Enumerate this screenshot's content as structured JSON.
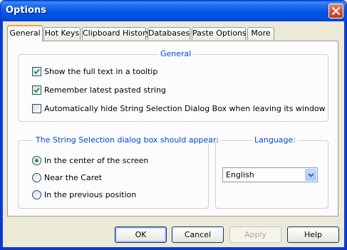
{
  "window": {
    "title": "Options"
  },
  "tabs": [
    {
      "label": "General",
      "active": true
    },
    {
      "label": "Hot Keys",
      "active": false
    },
    {
      "label": "Clipboard History",
      "active": false
    },
    {
      "label": "Databases",
      "active": false
    },
    {
      "label": "Paste Options",
      "active": false
    },
    {
      "label": "More",
      "active": false
    }
  ],
  "general_group": {
    "title": "General",
    "options": [
      {
        "label": "Show the full text in a tooltip",
        "checked": true
      },
      {
        "label": "Remember latest pasted string",
        "checked": true
      },
      {
        "label": "Automatically hide String Selection Dialog Box when leaving its window",
        "checked": false
      }
    ]
  },
  "position_group": {
    "title": "The String Selection dialog box should appear:",
    "options": [
      {
        "label": "In the center of the screen",
        "selected": true
      },
      {
        "label": "Near the Caret",
        "selected": false
      },
      {
        "label": "In the previous position",
        "selected": false
      }
    ]
  },
  "language_group": {
    "title": "Language:",
    "selected": "English"
  },
  "buttons": {
    "ok": "OK",
    "cancel": "Cancel",
    "apply": "Apply",
    "help": "Help"
  },
  "colors": {
    "title_bar": "#0454e3",
    "group_title": "#0046d5",
    "check_mark": "#21a121",
    "active_tab_highlight": "#f2a53b"
  }
}
